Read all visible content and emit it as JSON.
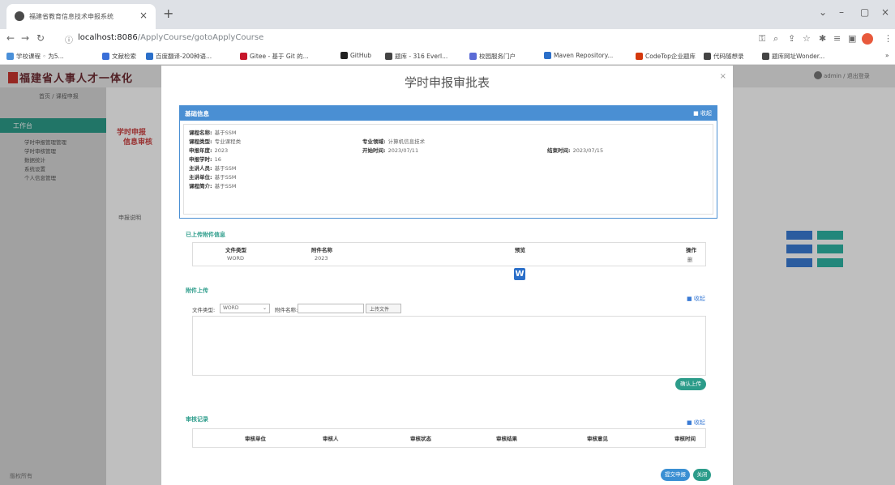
{
  "browser": {
    "tab_title": "福建省教育信息技术申报系统",
    "new_tab": "+",
    "url_host": "localhost:8086",
    "url_path": "/ApplyCourse/gotoApplyCourse",
    "bookmarks": [
      {
        "label": "学校课程 ◦ 为5...",
        "icon": "folder-icon",
        "color": "#4a90d9"
      },
      {
        "label": "文献检索",
        "icon": "diamond-icon",
        "color": "#3a6fd8"
      },
      {
        "label": "百度翻译-200种语...",
        "icon": "translate-icon",
        "color": "#2b6fc9"
      },
      {
        "label": "Gitee - 基于 Git 的...",
        "icon": "gitee-icon",
        "color": "#c7162b"
      },
      {
        "label": "GitHub",
        "icon": "github-icon",
        "color": "#222222"
      },
      {
        "label": "题库 - 316 Everl...",
        "icon": "c-icon",
        "color": "#444444"
      },
      {
        "label": "校园服务门户",
        "icon": "portal-icon",
        "color": "#5b6bd6"
      },
      {
        "label": "Maven Repository...",
        "icon": "maven-icon",
        "color": "#2b6fc9"
      },
      {
        "label": "CodeTop企业题库",
        "icon": "codetop-icon",
        "color": "#d4380d"
      },
      {
        "label": "代码随想录",
        "icon": "pin-icon",
        "color": "#444444"
      },
      {
        "label": "题库网址Wonder...",
        "icon": "globe-icon",
        "color": "#444444"
      }
    ]
  },
  "app": {
    "brand": "福建省人事人才一体化",
    "header_user": "admin / 退出登录",
    "breadcrumb": "首页 / 课程申报",
    "sidebar_active": "工作台",
    "sidebar_items": [
      "学时申报管理管理",
      "学时审核管理",
      "数据统计",
      "系统设置",
      "个人信息管理"
    ],
    "footer": "版权所有",
    "bg_heading_1": "学时申报",
    "bg_heading_2": "信息审核",
    "bg_note": "申报说明"
  },
  "modal": {
    "title": "学时申报审批表",
    "close": "×",
    "basic_info": {
      "title": "基础信息",
      "action": "■ 收起",
      "fields": [
        {
          "label": "课程名称:",
          "value": "基于SSM"
        },
        {
          "label": "课程类型:",
          "value": "专业课程类"
        },
        {
          "label": "申报年度:",
          "value": "2023"
        },
        {
          "label": "申报学时:",
          "value": "16"
        },
        {
          "label": "主讲人员:",
          "value": "基于SSM"
        },
        {
          "label": "主讲单位:",
          "value": "基于SSM"
        },
        {
          "label": "课程简介:",
          "value": "基于SSM"
        }
      ],
      "mid_fields": [
        {
          "label": "专业领域:",
          "value": "计算机信息技术"
        },
        {
          "label": "开始时间:",
          "value": "2023/07/11"
        }
      ],
      "right_fields": [
        {
          "label": "结束时间:",
          "value": "2023/07/15"
        }
      ]
    },
    "attachments": {
      "title": "已上传附件信息",
      "columns": [
        "文件类型",
        "附件名称",
        "预览",
        "操作"
      ],
      "rows": [
        {
          "type": "WORD",
          "name": "2023",
          "preview": "W",
          "op": "删"
        }
      ]
    },
    "upload": {
      "title": "附件上传",
      "action": "■ 收起",
      "type_label": "文件类型:",
      "type_value": "WORD",
      "name_label": "附件名称:",
      "file_button": "上传文件",
      "submit": "确认上传"
    },
    "review": {
      "title": "审核记录",
      "action": "■ 收起",
      "columns": [
        "审核单位",
        "审核人",
        "审核状态",
        "审核结果",
        "审核意见",
        "审核时间"
      ]
    },
    "footer_buttons": {
      "submit": "提交申报",
      "close": "关闭"
    }
  }
}
